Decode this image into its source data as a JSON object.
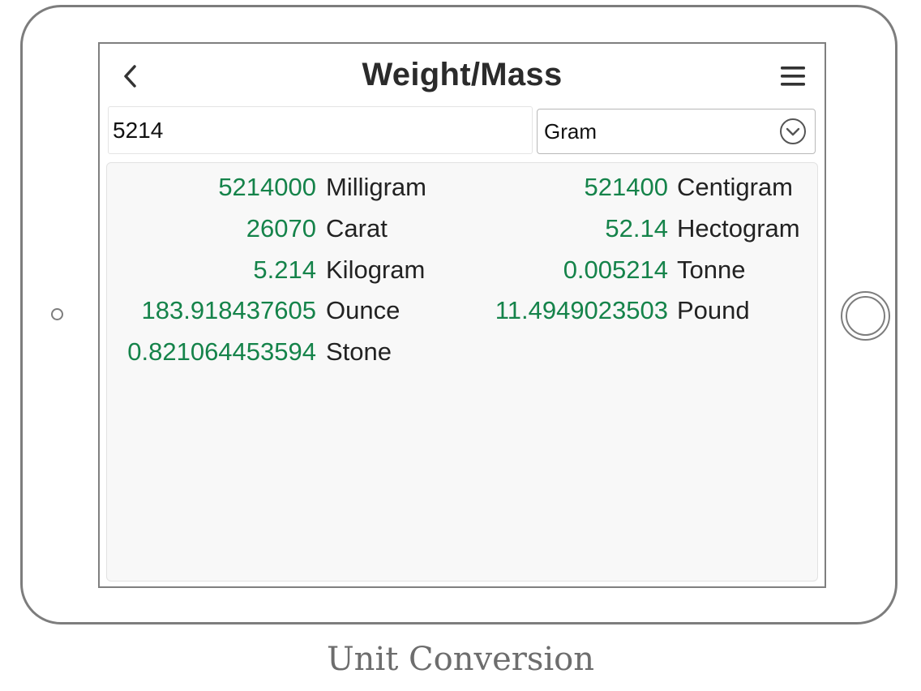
{
  "header": {
    "title": "Weight/Mass",
    "back_icon": "chevron-left-icon",
    "menu_icon": "hamburger-menu-icon"
  },
  "input": {
    "value": "5214"
  },
  "unit_select": {
    "selected": "Gram",
    "icon": "chevron-down-circle-icon"
  },
  "results": [
    {
      "value": "5214000",
      "unit": "Milligram"
    },
    {
      "value": "521400",
      "unit": "Centigram"
    },
    {
      "value": "26070",
      "unit": "Carat"
    },
    {
      "value": "52.14",
      "unit": "Hectogram"
    },
    {
      "value": "5.214",
      "unit": "Kilogram"
    },
    {
      "value": "0.005214",
      "unit": "Tonne"
    },
    {
      "value": "183.918437605",
      "unit": "Ounce"
    },
    {
      "value": "11.4949023503",
      "unit": "Pound"
    },
    {
      "value": "0.821064453594",
      "unit": "Stone"
    }
  ],
  "caption": "Unit Conversion",
  "colors": {
    "value_green": "#15834a",
    "frame_gray": "#7d7d7d",
    "panel_bg": "#f8f8f8"
  }
}
